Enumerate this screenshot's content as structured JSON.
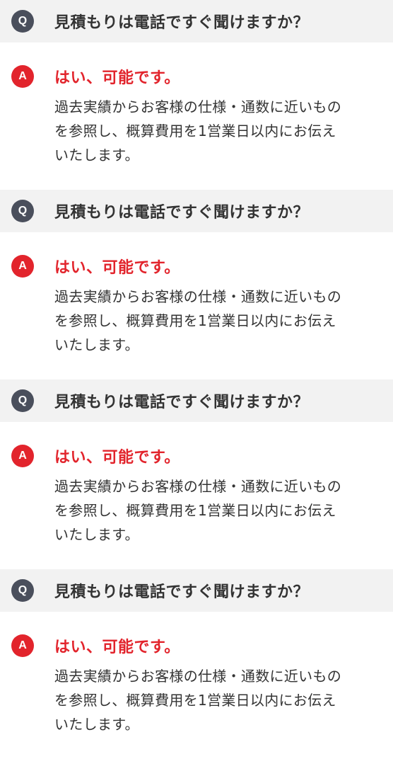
{
  "faq": {
    "items": [
      {
        "q_badge": "Q",
        "question": "見積もりは電話ですぐ聞けますか？",
        "a_badge": "A",
        "answer_title": "はい、可能です。",
        "answer_lines": [
          "過去実績からお客様の仕様・通数に近いもの",
          "を参照し、概算費用を1営業日以内にお伝え",
          "いたします。"
        ]
      },
      {
        "q_badge": "Q",
        "question": "見積もりは電話ですぐ聞けますか？",
        "a_badge": "A",
        "answer_title": "はい、可能です。",
        "answer_lines": [
          "過去実績からお客様の仕様・通数に近いもの",
          "を参照し、概算費用を1営業日以内にお伝え",
          "いたします。"
        ]
      },
      {
        "q_badge": "Q",
        "question": "見積もりは電話ですぐ聞けますか？",
        "a_badge": "A",
        "answer_title": "はい、可能です。",
        "answer_lines": [
          "過去実績からお客様の仕様・通数に近いもの",
          "を参照し、概算費用を1営業日以内にお伝え",
          "いたします。"
        ]
      },
      {
        "q_badge": "Q",
        "question": "見積もりは電話ですぐ聞けますか？",
        "a_badge": "A",
        "answer_title": "はい、可能です。",
        "answer_lines": [
          "過去実績からお客様の仕様・通数に近いもの",
          "を参照し、概算費用を1営業日以内にお伝え",
          "いたします。"
        ]
      }
    ]
  },
  "colors": {
    "question_bg": "#f2f2f2",
    "q_badge": "#4a4f5c",
    "a_badge": "#e2242c",
    "answer_title": "#e2242c",
    "text": "#333333"
  }
}
